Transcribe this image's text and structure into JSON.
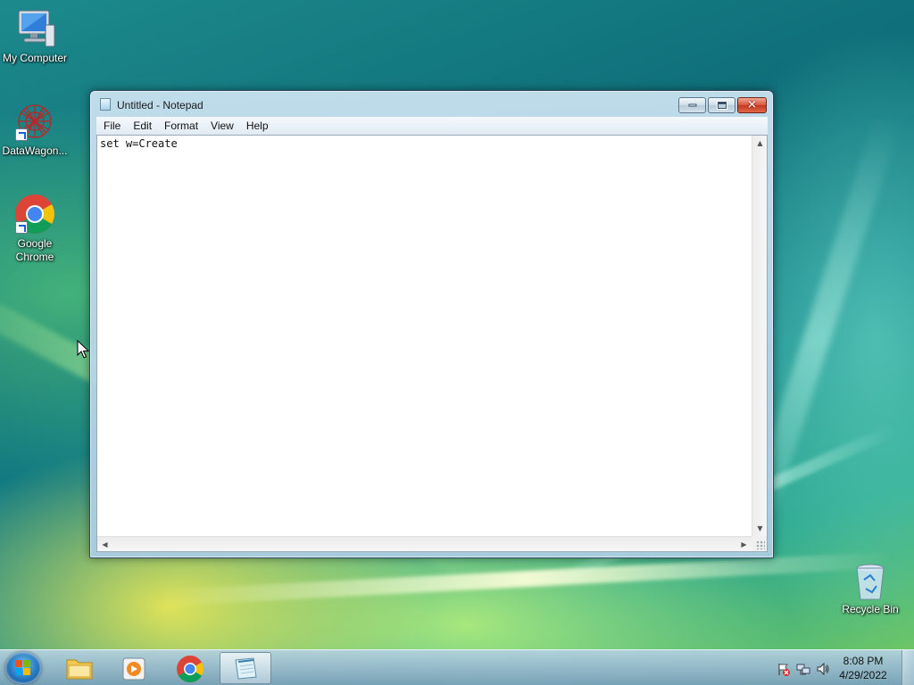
{
  "desktop": {
    "icons": [
      {
        "label": "My Computer"
      },
      {
        "label": "DataWagon..."
      },
      {
        "label": "Google\nChrome"
      },
      {
        "label": "Recycle Bin"
      }
    ]
  },
  "notepad": {
    "title": "Untitled - Notepad",
    "menu": [
      "File",
      "Edit",
      "Format",
      "View",
      "Help"
    ],
    "content": "set w=Create",
    "close_glyph": "✕"
  },
  "taskbar": {
    "clock_time": "8:08 PM",
    "clock_date": "4/29/2022"
  },
  "colors": {
    "chrome_red": "#db4437",
    "chrome_yellow": "#f4c20d",
    "chrome_green": "#0f9d58",
    "chrome_blue": "#4285f4",
    "close_red": "#c0391f"
  }
}
